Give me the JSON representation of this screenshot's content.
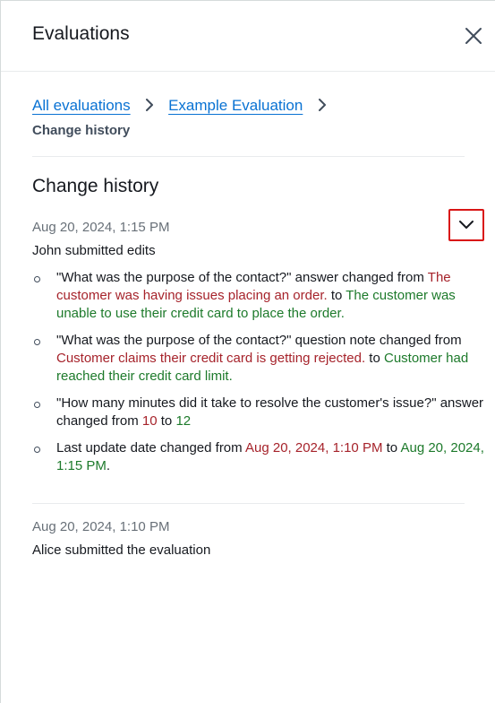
{
  "header": {
    "title": "Evaluations"
  },
  "breadcrumb": {
    "items": [
      {
        "label": "All evaluations"
      },
      {
        "label": "Example Evaluation"
      }
    ],
    "current": "Change history"
  },
  "section": {
    "title": "Change history"
  },
  "entries": [
    {
      "timestamp": "Aug 20, 2024, 1:15 PM",
      "summary": "John submitted edits",
      "changes": [
        {
          "prefix": "\"What was the purpose of the contact?\" answer changed from ",
          "old_value": "The customer was having issues placing an order.",
          "mid": " to ",
          "new_value": "The customer was unable to use their credit card to place the order.",
          "suffix": ""
        },
        {
          "prefix": "\"What was the purpose of the contact?\" question note changed from ",
          "old_value": "Customer claims their credit card is getting rejected.",
          "mid": " to ",
          "new_value": "Customer had reached their credit card limit.",
          "suffix": ""
        },
        {
          "prefix": "\"How many minutes did it take to resolve the customer's issue?\" answer changed from ",
          "old_value": "10",
          "mid": " to ",
          "new_value": "12",
          "suffix": ""
        },
        {
          "prefix": "Last update date changed from ",
          "old_value": "Aug 20, 2024, 1:10 PM",
          "mid": " to ",
          "new_value": "Aug 20, 2024, 1:15 PM",
          "suffix": "."
        }
      ]
    },
    {
      "timestamp": "Aug 20, 2024, 1:10 PM",
      "summary": "Alice submitted the evaluation"
    }
  ],
  "colors": {
    "link": "#0972d3",
    "old_value": "#a6232b",
    "new_value": "#1d7a2b",
    "highlight_border": "#d91515"
  },
  "icons": {
    "close": "close-icon",
    "breadcrumb_separator": "chevron-right-icon",
    "expand": "chevron-down-icon"
  }
}
